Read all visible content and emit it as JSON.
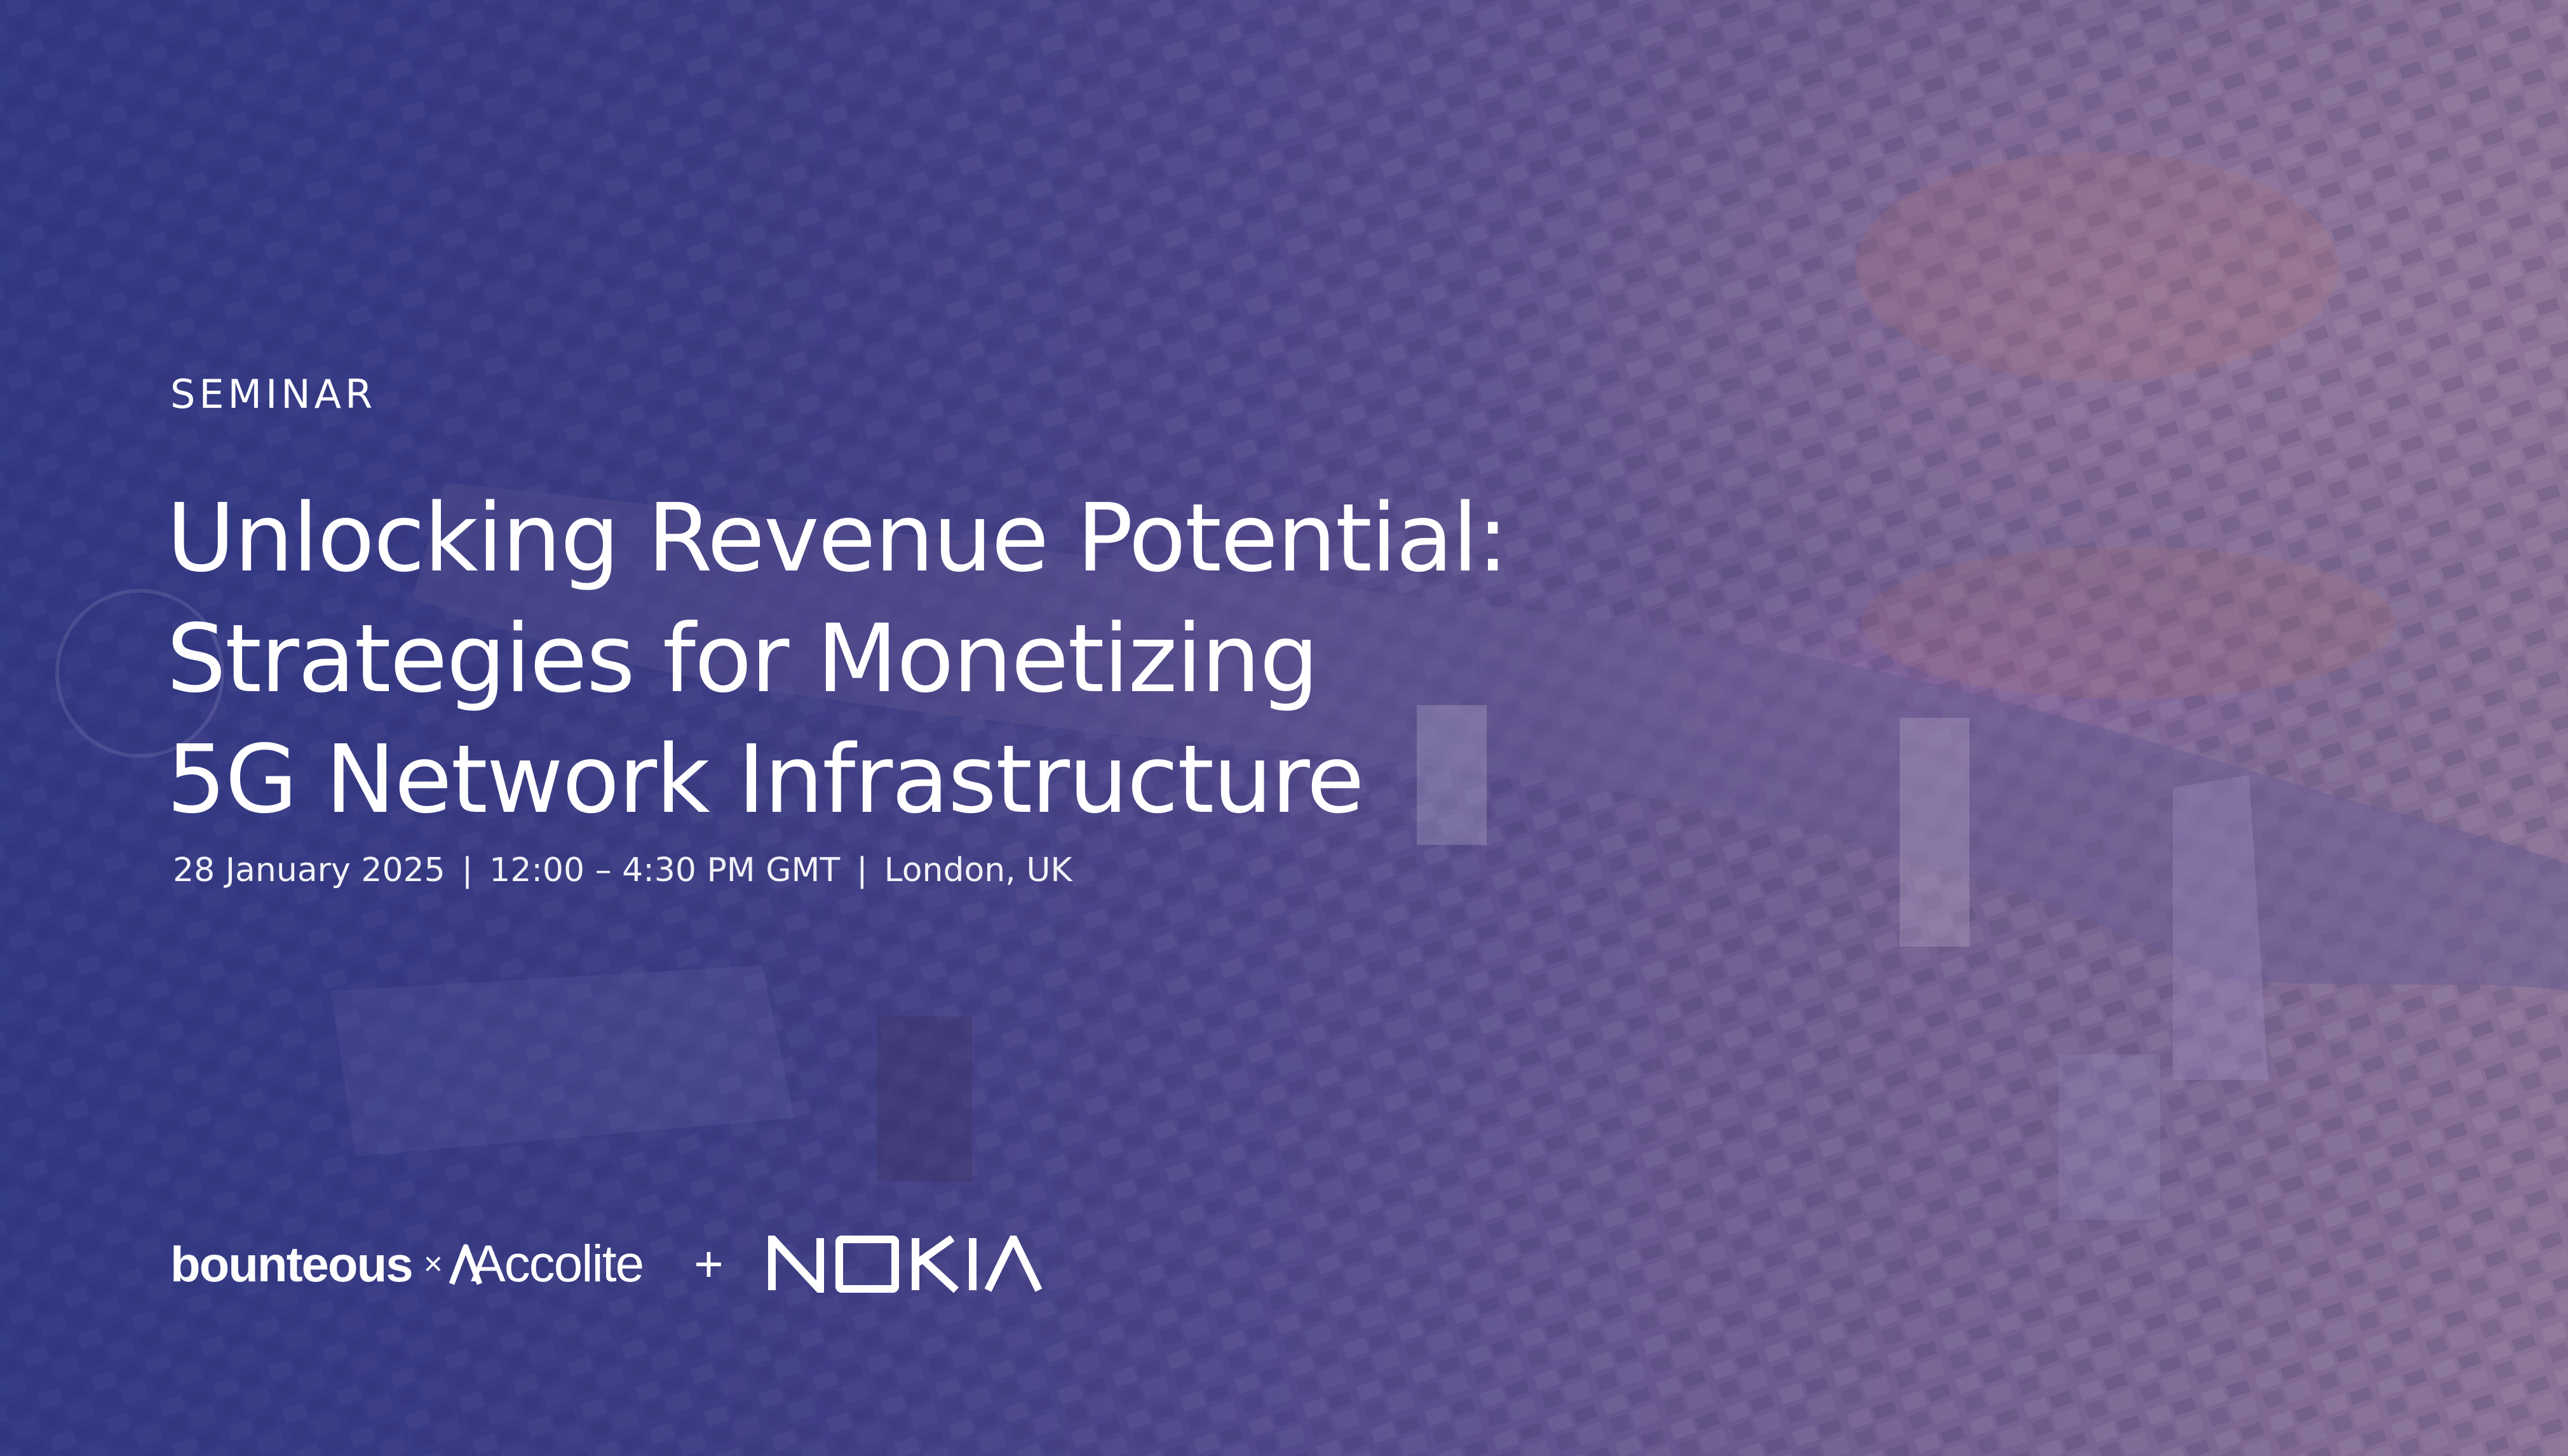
{
  "event": {
    "category": "SEMINAR",
    "title_lines": [
      "Unlocking Revenue Potential:",
      "Strategies for Monetizing",
      "5G Network Infrastructure"
    ],
    "date": "28 January 2025",
    "time": "12:00 – 4:30 PM GMT",
    "location": "London, UK",
    "separator": "|"
  },
  "sponsors": {
    "brand_1": "bounteous",
    "joiner": "×",
    "brand_2": "Accolite",
    "plus": "+",
    "brand_3": "NOKIA"
  },
  "colors": {
    "overlay_tint": "#343b86",
    "text": "#ffffff"
  },
  "background": {
    "description_icon": "aerial-city-river-photo"
  }
}
